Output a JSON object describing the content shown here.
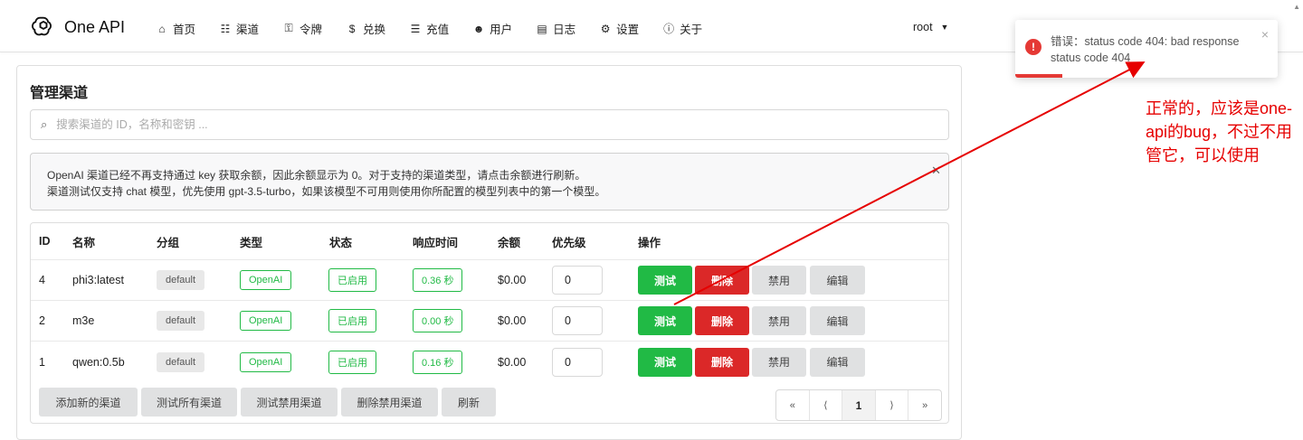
{
  "app": {
    "name": "One API"
  },
  "nav": [
    {
      "icon": "home-icon",
      "glyph": "⌂",
      "label": "首页"
    },
    {
      "icon": "sitemap-icon",
      "glyph": "☷",
      "label": "渠道"
    },
    {
      "icon": "key-icon",
      "glyph": "⚿",
      "label": "令牌"
    },
    {
      "icon": "dollar-icon",
      "glyph": "$",
      "label": "兑换"
    },
    {
      "icon": "cart-icon",
      "glyph": "☰",
      "label": "充值"
    },
    {
      "icon": "user-icon",
      "glyph": "☻",
      "label": "用户"
    },
    {
      "icon": "book-icon",
      "glyph": "▤",
      "label": "日志"
    },
    {
      "icon": "gear-icon",
      "glyph": "⚙",
      "label": "设置"
    },
    {
      "icon": "info-icon",
      "glyph": "ⓘ",
      "label": "关于"
    }
  ],
  "user": {
    "name": "root"
  },
  "page": {
    "title": "管理渠道"
  },
  "search": {
    "placeholder": "搜索渠道的 ID，名称和密钥 ..."
  },
  "notice": {
    "line1": "OpenAI 渠道已经不再支持通过 key 获取余额，因此余额显示为 0。对于支持的渠道类型，请点击余额进行刷新。",
    "line2": "渠道测试仅支持 chat 模型，优先使用 gpt-3.5-turbo，如果该模型不可用则使用你所配置的模型列表中的第一个模型。"
  },
  "table": {
    "headers": [
      "ID",
      "名称",
      "分组",
      "类型",
      "状态",
      "响应时间",
      "余额",
      "优先级",
      "操作"
    ],
    "rows": [
      {
        "id": "4",
        "name": "phi3:latest",
        "group": "default",
        "type": "OpenAI",
        "status": "已启用",
        "time": "0.36 秒",
        "balance": "$0.00",
        "priority": "0"
      },
      {
        "id": "2",
        "name": "m3e",
        "group": "default",
        "type": "OpenAI",
        "status": "已启用",
        "time": "0.00 秒",
        "balance": "$0.00",
        "priority": "0"
      },
      {
        "id": "1",
        "name": "qwen:0.5b",
        "group": "default",
        "type": "OpenAI",
        "status": "已启用",
        "time": "0.16 秒",
        "balance": "$0.00",
        "priority": "0"
      }
    ],
    "actions": {
      "test": "测试",
      "delete": "删除",
      "disable": "禁用",
      "edit": "编辑"
    }
  },
  "bottom": {
    "add": "添加新的渠道",
    "test_all": "测试所有渠道",
    "test_disabled": "测试禁用渠道",
    "delete_disabled": "删除禁用渠道",
    "refresh": "刷新"
  },
  "pager": {
    "first": "«",
    "prev": "⟨",
    "current": "1",
    "next": "⟩",
    "last": "»"
  },
  "toast": {
    "message": "错误：status code 404: bad response status code 404",
    "close": "×"
  },
  "annotation": {
    "text": "正常的，应该是one-api的bug，不过不用管它，可以使用"
  },
  "colors": {
    "green": "#21ba45",
    "red": "#db2828",
    "annotation": "#e60000",
    "error": "#e53935"
  }
}
